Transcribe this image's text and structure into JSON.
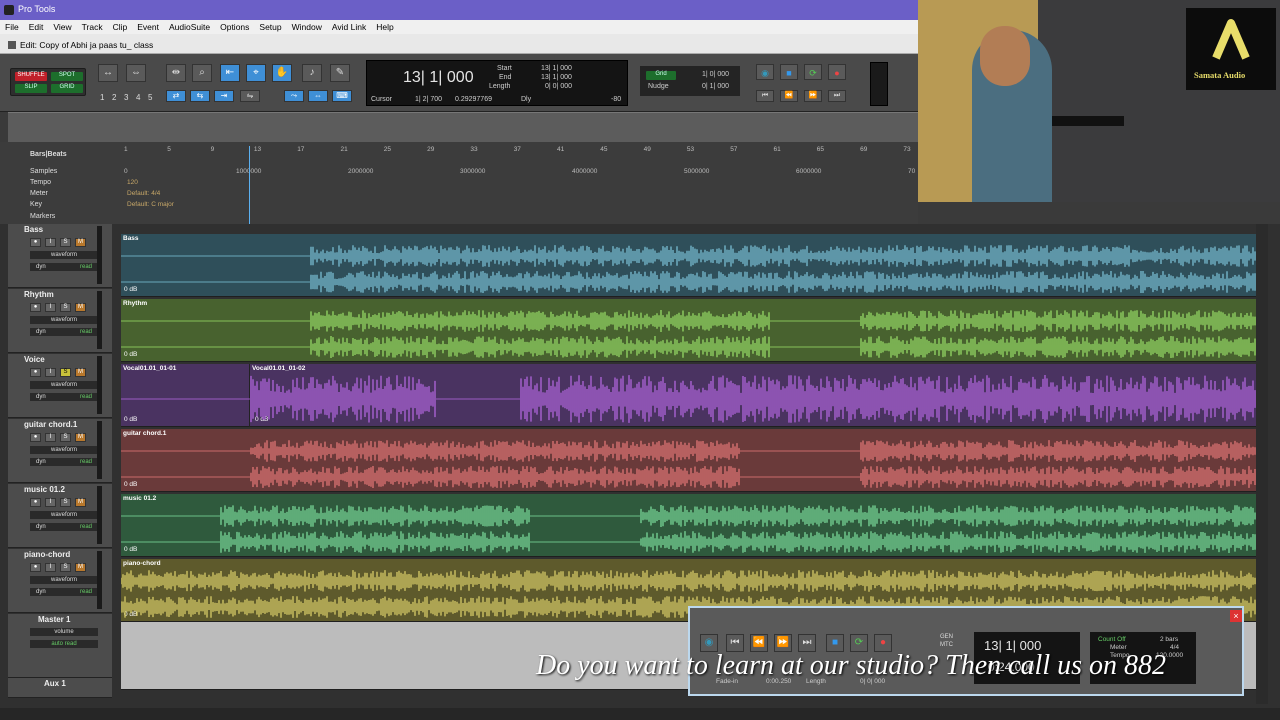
{
  "window": {
    "title": "Pro Tools",
    "edit_title": "Edit: Copy of Abhi ja paas tu_ class"
  },
  "menu": [
    "File",
    "Edit",
    "View",
    "Track",
    "Clip",
    "Event",
    "AudioSuite",
    "Options",
    "Setup",
    "Window",
    "Avid Link",
    "Help"
  ],
  "modes": {
    "shuffle": "SHUFFLE",
    "spot": "SPOT",
    "slip": "SLIP",
    "grid": "GRID"
  },
  "zoom_presets": [
    "1",
    "2",
    "3",
    "4",
    "5"
  ],
  "counter": {
    "main": "13| 1| 000",
    "start_label": "Start",
    "end_label": "End",
    "length_label": "Length",
    "start": "13| 1| 000",
    "end": "13| 1| 000",
    "length": "0| 0| 000",
    "cursor_label": "Cursor",
    "cursor": "1| 2| 700",
    "cursor_sample": "0.29297769",
    "dly": "Dly",
    "value80": "-80"
  },
  "grid_nudge": {
    "grid_label": "Grid",
    "grid": "1| 0| 000",
    "nudge_label": "Nudge",
    "nudge": "0| 1| 000"
  },
  "rulers": {
    "bars_label": "Bars|Beats",
    "samples_label": "Samples",
    "tempo_label": "Tempo",
    "meter_label": "Meter",
    "key_label": "Key",
    "markers_label": "Markers",
    "tempo_val": "120",
    "meter_val": "Default: 4/4",
    "key_val": "Default: C major",
    "bar_ticks": [
      "1",
      "5",
      "9",
      "13",
      "17",
      "21",
      "25",
      "29",
      "33",
      "37",
      "41",
      "45",
      "49",
      "53",
      "57",
      "61",
      "65",
      "69",
      "73"
    ],
    "sample_ticks": [
      "0",
      "1000000",
      "2000000",
      "3000000",
      "4000000",
      "5000000",
      "6000000",
      "70"
    ]
  },
  "tracks": [
    {
      "name": "Bass",
      "view": "waveform",
      "auto": "read",
      "dyn": "dyn",
      "clip": "Bass",
      "db": "0 dB",
      "color": "#2f4f5a",
      "wave": "#7ec6dc"
    },
    {
      "name": "Rhythm",
      "view": "waveform",
      "auto": "read",
      "dyn": "dyn",
      "clip": "Rhythm",
      "db": "0 dB",
      "color": "#48622f",
      "wave": "#9be36a"
    },
    {
      "name": "Voice",
      "view": "waveform",
      "auto": "read",
      "dyn": "dyn",
      "clip": "Vocal01.01_01-01",
      "clip2": "Vocal01.01_01-02",
      "db": "0 dB",
      "db2": "0 dB",
      "color": "#4a3361",
      "wave": "#b869e6"
    },
    {
      "name": "guitar chord.1",
      "view": "waveform",
      "auto": "read",
      "dyn": "dyn",
      "clip": "guitar chord.1",
      "db": "0 dB",
      "color": "#6a3a3a",
      "wave": "#ea7a7a"
    },
    {
      "name": "music 01.2",
      "view": "waveform",
      "auto": "read",
      "dyn": "dyn",
      "clip": "music 01.2",
      "db": "0 dB",
      "color": "#2f5a3d",
      "wave": "#7fe2a0"
    },
    {
      "name": "piano-chord",
      "view": "waveform",
      "auto": "read",
      "dyn": "dyn",
      "clip": "piano-chord",
      "db": "0 dB",
      "color": "#5e5a2c",
      "wave": "#e2d66d"
    }
  ],
  "master": {
    "name": "Master 1",
    "view": "volume",
    "auto": "auto read"
  },
  "aux": {
    "name": "Aux 1"
  },
  "track_buttons": {
    "rec": "●",
    "input": "I",
    "solo": "S",
    "mute": "M"
  },
  "webcam": {
    "brand": "Samata Audio",
    "desc": "Presenter at studio desk with keyboards"
  },
  "float_transport": {
    "main": "13| 1| 000",
    "sub": "0:24.000",
    "fade_label": "Fade-in",
    "fade": "0:00.250",
    "length_label": "Length",
    "length": "0| 0| 000",
    "count_off": "Count Off",
    "meter_label": "Meter",
    "tempo_label": "Tempo",
    "bars": "2 bars",
    "meter": "4/4",
    "tempo": "120.0000",
    "gen": "GEN",
    "mtc": "MTC"
  },
  "caption": "Do you want to learn at our studio? Then call us on 882"
}
